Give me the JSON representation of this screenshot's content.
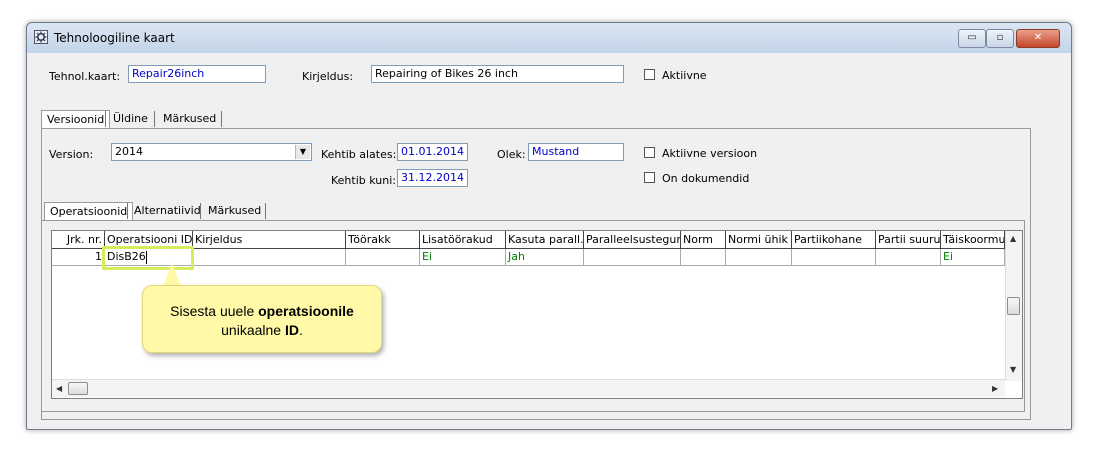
{
  "window": {
    "title": "Tehnoloogiline kaart",
    "buttons": {
      "minimize": "▭",
      "maximize": "▫",
      "close": "✕"
    }
  },
  "header": {
    "tehnol_label": "Tehnol.kaart:",
    "tehnol_value": "Repair26inch",
    "kirjeldus_label": "Kirjeldus:",
    "kirjeldus_value": "Repairing of Bikes 26 inch",
    "aktiivne_label": "Aktiivne"
  },
  "tabs": [
    "Versioonid",
    "Üldine",
    "Märkused"
  ],
  "version": {
    "version_label": "Version:",
    "version_value": "2014",
    "kehtib_alates_label": "Kehtib alates:",
    "kehtib_alates_value": "01.01.2014",
    "kehtib_kuni_label": "Kehtib kuni:",
    "kehtib_kuni_value": "31.12.2014",
    "olek_label": "Olek:",
    "olek_value": "Mustand",
    "aktiivne_versioon_label": "Aktiivne versioon",
    "on_dokumendid_label": "On dokumendid"
  },
  "subtabs": [
    "Operatsioonid",
    "Alternatiivid",
    "Märkused"
  ],
  "grid": {
    "columns": [
      "Jrk. nr.",
      "Operatsiooni ID",
      "Kirjeldus",
      "Töörakk",
      "Lisatöörakud",
      "Kasuta parall.",
      "Paralleelsustegur",
      "Norm",
      "Normi ühik",
      "Partiikohane",
      "Partii suurus",
      "Täiskoormus"
    ],
    "row": [
      "1",
      "DisB26",
      "",
      "",
      "Ei",
      "Jah",
      "",
      "",
      "",
      "",
      "",
      "Ei"
    ]
  },
  "callout": {
    "line1_prefix": "Sisesta uuele ",
    "line1_bold": "operatsioonile",
    "line2_prefix": "unikaalne ",
    "line2_bold": "ID",
    "line2_suffix": "."
  }
}
